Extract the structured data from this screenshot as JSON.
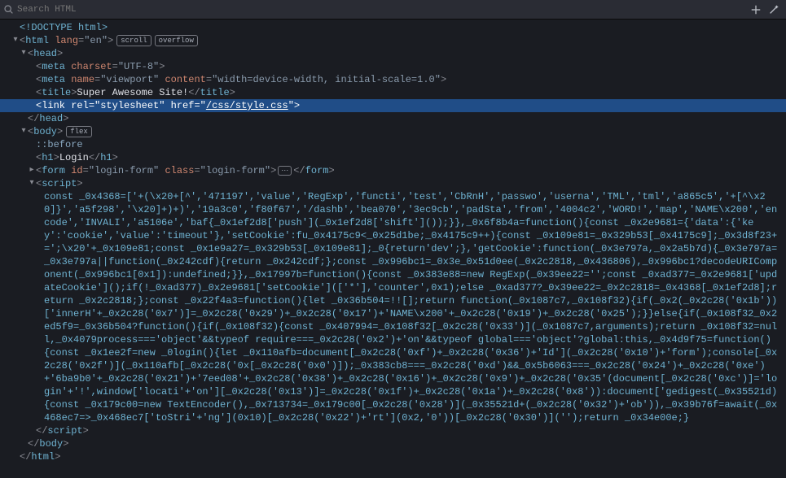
{
  "toolbar": {
    "search_placeholder": "Search HTML"
  },
  "tree": {
    "doctype": "<!DOCTYPE html>",
    "html_open_prefix": "<",
    "html_tag": "html",
    "html_attr_lang": "lang",
    "html_attr_lang_val": "\"en\"",
    "badge_scroll": "scroll",
    "badge_overflow": "overflow",
    "head_tag": "head",
    "meta1_tag": "meta",
    "meta1_attr": "charset",
    "meta1_val": "\"UTF-8\"",
    "meta2_tag": "meta",
    "meta2_attr_name": "name",
    "meta2_val_name": "\"viewport\"",
    "meta2_attr_content": "content",
    "meta2_val_content": "\"width=device-width, initial-scale=1.0\"",
    "title_tag": "title",
    "title_text": "Super Awesome Site!",
    "link_tag": "link",
    "link_attr_rel": "rel",
    "link_val_rel": "\"stylesheet\"",
    "link_attr_href": "href",
    "link_val_href": "/css/style.css",
    "body_tag": "body",
    "badge_flex": "flex",
    "pseudo_before": "::before",
    "h1_tag": "h1",
    "h1_text": "Login",
    "form_tag": "form",
    "form_attr_id": "id",
    "form_val_id": "\"login-form\"",
    "form_attr_class": "class",
    "form_val_class": "\"login-form\"",
    "script_tag": "script"
  },
  "script_body": "const _0x4368=['+(\\x20+[^','471197','value','RegExp','functi','test','CbRnH','passwo','userna','TML','tml','a865c5','+[^\\x20]}','a5f298','\\x20]+)+)','19a3c0','f80f67','/dashb','bea070','3ec9cb','padSta','from','4004c2','WORD!','map','NAME\\x200','encode','INVALI','a5106e','baf{_0x1ef2d8['push'](_0x1ef2d8['shift']());}},_0x6f8b4a=function(){const _0x2e9681={'data':{'key':'cookie','value':'timeout'},'setCookie':fu_0x4175c9<_0x25d1be;_0x4175c9++){const _0x109e81=_0x329b53[_0x4175c9];_0x3d8f23+=';\\x20'+_0x109e81;const _0x1e9a27=_0x329b53[_0x109e81];_0{return'dev';},'getCookie':function(_0x3e797a,_0x2a5b7d){_0x3e797a=_0x3e797a||function(_0x242cdf){return _0x242cdf;};const _0x996bc1=_0x3e_0x51d0ee(_0x2c2818,_0x436806),_0x996bc1?decodeURIComponent(_0x996bc1[0x1]):undefined;}},_0x17997b=function(){const _0x383e88=new RegExp(_0x39ee22='';const _0xad377=_0x2e9681['updateCookie']();if(!_0xad377)_0x2e9681['setCookie'](['*'],'counter',0x1);else _0xad377?_0x39ee22=_0x2c2818=_0x4368[_0x1ef2d8];return _0x2c2818;};const _0x22f4a3=function(){let _0x36b504=!![];return function(_0x1087c7,_0x108f32){if(_0x2(_0x2c28('0x1b'))['innerH'+_0x2c28('0x7')]=_0x2c28('0x29')+_0x2c28('0x17')+'NAME\\x200'+_0x2c28('0x19')+_0x2c28('0x25');}}else{if(_0x108f32_0x2ed5f9=_0x36b504?function(){if(_0x108f32){const _0x407994=_0x108f32[_0x2c28('0x33')](_0x1087c7,arguments);return _0x108f32=null,_0x4079process==='object'&&typeof require===_0x2c28('0x2')+'on'&&typeof global==='object'?global:this,_0x4d9f75=function(){const _0x1ee2f=new _0login(){let _0x110afb=document[_0x2c28('0xf')+_0x2c28('0x36')+'Id'](_0x2c28('0x10')+'form');console[_0x2c28('0x2f')](_0x110afb[_0x2c28('0x[_0x2c28('0x0')]);_0x383cb8===_0x2c28('0xd')&&_0x5b6063===_0x2c28('0x24')+_0x2c28('0xe')+'6ba9b0'+_0x2c28('0x21')+'7eed08'+_0x2c28('0x38')+_0x2c28('0x16')+_0x2c28('0x9')+_0x2c28('0x35'(document[_0x2c28('0xc')]='login'+'!',window['locati'+'on'][_0x2c28('0x13')]=_0x2c28('0x1f')+_0x2c28('0x1a')+_0x2c28('0x8')):document['gedigest(_0x35521d){const _0x179c00=new TextEncoder(),_0x713734=_0x179c00[_0x2c28('0x28')](_0x35521d+(_0x2c28('0x32')+'ob')),_0x39b76f=await(_0x468ec7=>_0x468ec7['toStri'+'ng'](0x10)[_0x2c28('0x22')+'rt'](0x2,'0'))[_0x2c28('0x30')]('');return _0x34e00e;}"
}
